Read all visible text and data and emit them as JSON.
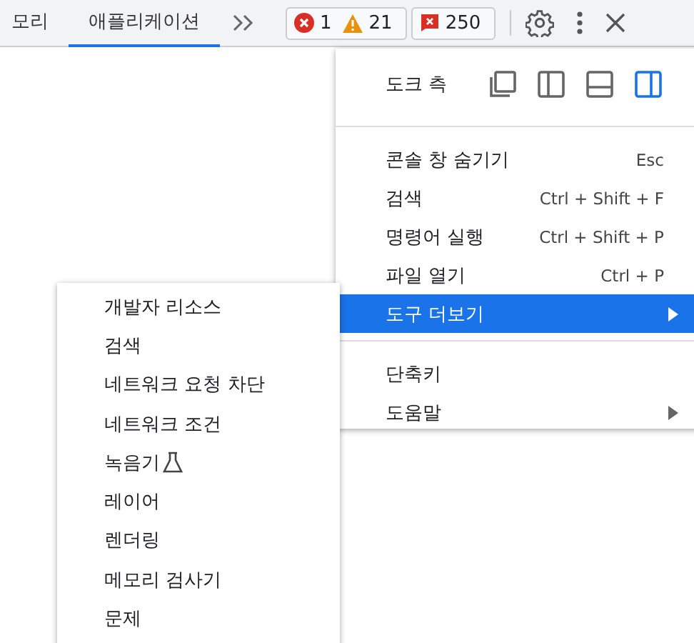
{
  "tabs": [
    {
      "label": "모리",
      "selected": false
    },
    {
      "label": "애플리케이션",
      "selected": true
    }
  ],
  "counters": [
    {
      "kind": "error",
      "count": "1"
    },
    {
      "kind": "warning",
      "count": "21"
    }
  ],
  "issues": {
    "count": "250"
  },
  "menu": {
    "dock": {
      "label": "도크 측",
      "options": [
        {
          "kind": "undock",
          "selected": false
        },
        {
          "kind": "left",
          "selected": false
        },
        {
          "kind": "bottom",
          "selected": false
        },
        {
          "kind": "right",
          "selected": true
        }
      ]
    },
    "groups": [
      [
        {
          "label": "콘솔 창 숨기기",
          "shortcut": "Esc",
          "submenu": false,
          "selected": false
        },
        {
          "label": "검색",
          "shortcut": "Ctrl + Shift + F",
          "submenu": false,
          "selected": false
        },
        {
          "label": "명령어 실행",
          "shortcut": "Ctrl + Shift + P",
          "submenu": false,
          "selected": false
        },
        {
          "label": "파일 열기",
          "shortcut": "Ctrl + P",
          "submenu": false,
          "selected": false
        },
        {
          "label": "도구 더보기",
          "submenu": true,
          "selected": true
        }
      ],
      [
        {
          "label": "단축키",
          "submenu": false,
          "selected": false
        },
        {
          "label": "도움말",
          "submenu": true,
          "selected": false
        }
      ]
    ]
  },
  "submenu": [
    {
      "label": "개발자 리소스",
      "experimental": false
    },
    {
      "label": "검색",
      "experimental": false
    },
    {
      "label": "네트워크 요청 차단",
      "experimental": false
    },
    {
      "label": "네트워크 조건",
      "experimental": false
    },
    {
      "label": "녹음기",
      "experimental": true
    },
    {
      "label": "레이어",
      "experimental": false
    },
    {
      "label": "렌더링",
      "experimental": false
    },
    {
      "label": "메모리 검사기",
      "experimental": false
    },
    {
      "label": "문제",
      "experimental": false
    }
  ]
}
